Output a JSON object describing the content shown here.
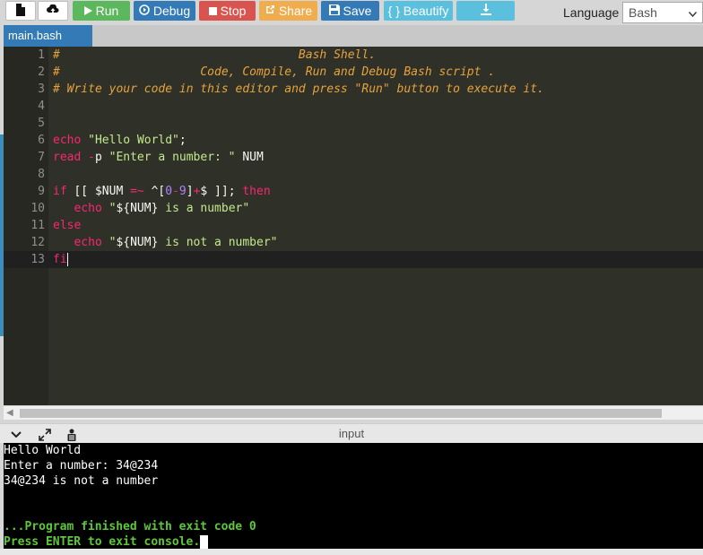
{
  "toolbar": {
    "new_file_icon": "file-icon",
    "upload_icon": "upload-icon",
    "run_label": "Run",
    "debug_label": "Debug",
    "stop_label": "Stop",
    "share_label": "Share",
    "save_label": "Save",
    "beautify_label": "{ } Beautify",
    "download_icon": "download-icon",
    "language_label": "Language",
    "language_value": "Bash"
  },
  "tabs": {
    "active_file": "main.bash"
  },
  "editor": {
    "line_numbers": [
      "1",
      "2",
      "3",
      "4",
      "5",
      "6",
      "7",
      "8",
      "9",
      "10",
      "11",
      "12",
      "13"
    ]
  },
  "console": {
    "title": "input",
    "lines": [
      "Hello World",
      "Enter a number: 34@234",
      "34@234 is not a number",
      "",
      "",
      "...Program finished with exit code 0",
      "Press ENTER to exit console."
    ]
  },
  "colors": {
    "run": "#5cb85c",
    "debug": "#337ab7",
    "stop": "#d9534f",
    "share": "#f0ad4e",
    "beautify": "#5bc0de",
    "editor_bg": "#2f3129",
    "comment": "#e6a23c",
    "keyword": "#f92672",
    "string": "#c3e88d",
    "console_success": "#5ec83a"
  }
}
